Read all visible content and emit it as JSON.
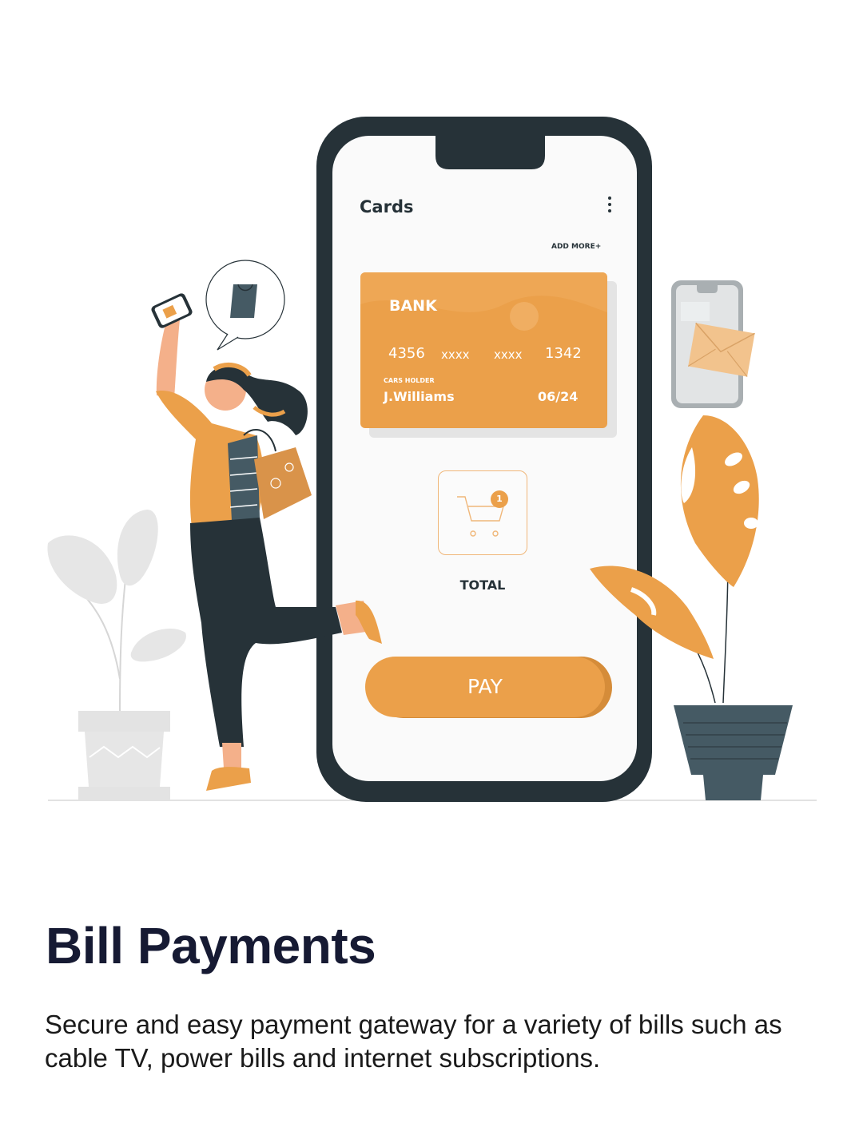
{
  "phone_screen": {
    "title": "Cards",
    "menu_icon": "more-vertical-icon",
    "add_more_label": "ADD MORE+",
    "card": {
      "bank_name": "BANK",
      "number_groups": [
        "4356",
        "xxxx",
        "xxxx",
        "1342"
      ],
      "holder_label": "CARS HOLDER",
      "holder_name": "J.Williams",
      "expiry": "06/24"
    },
    "cart_icon": "shopping-cart-icon",
    "cart_badge": "1",
    "total_label": "TOTAL",
    "pay_label": "PAY"
  },
  "onboarding": {
    "headline": "Bill Payments",
    "description": "Secure and easy payment gateway for a variety of bills such as cable TV, power bills and internet subscriptions."
  },
  "colors": {
    "accent": "#eba04a",
    "dark": "#263238",
    "headline": "#161a33",
    "plant_grey": "#e0e0e0",
    "pot_dark": "#455a64"
  }
}
